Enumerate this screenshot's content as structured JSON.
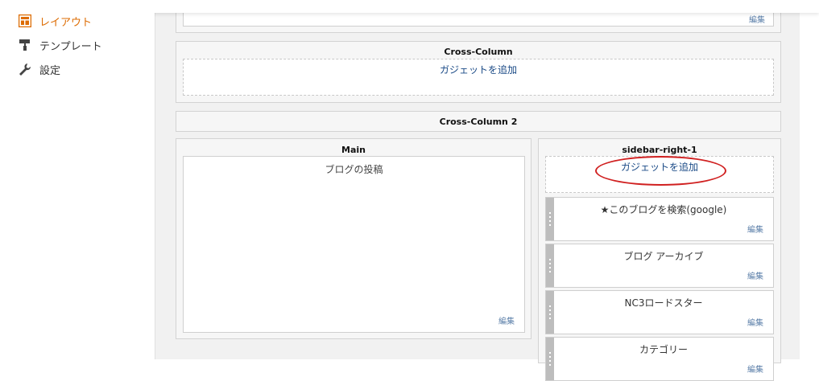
{
  "nav": {
    "items": [
      {
        "label": "レイアウト",
        "icon": "layout-icon",
        "active": true
      },
      {
        "label": "テンプレート",
        "icon": "paint-roller-icon",
        "active": false
      },
      {
        "label": "設定",
        "icon": "wrench-icon",
        "active": false
      }
    ]
  },
  "top_section": {
    "edit_label": "編集"
  },
  "cross_column": {
    "title": "Cross-Column",
    "add_gadget": "ガジェットを追加"
  },
  "cross_column_2": {
    "title": "Cross-Column 2"
  },
  "main": {
    "title": "Main",
    "blog_posts": "ブログの投稿",
    "edit_label": "編集"
  },
  "sidebar_right": {
    "title": "sidebar-right-1",
    "add_gadget": "ガジェットを追加",
    "widgets": [
      {
        "title": "★このブログを検索(google)",
        "edit_label": "編集"
      },
      {
        "title": "ブログ アーカイブ",
        "edit_label": "編集"
      },
      {
        "title": "NC3ロードスター",
        "edit_label": "編集"
      },
      {
        "title": "カテゴリー",
        "edit_label": "編集"
      }
    ]
  },
  "colors": {
    "accent": "#dd6b00",
    "link": "#1a4a86",
    "highlight_oval": "#d02020"
  }
}
